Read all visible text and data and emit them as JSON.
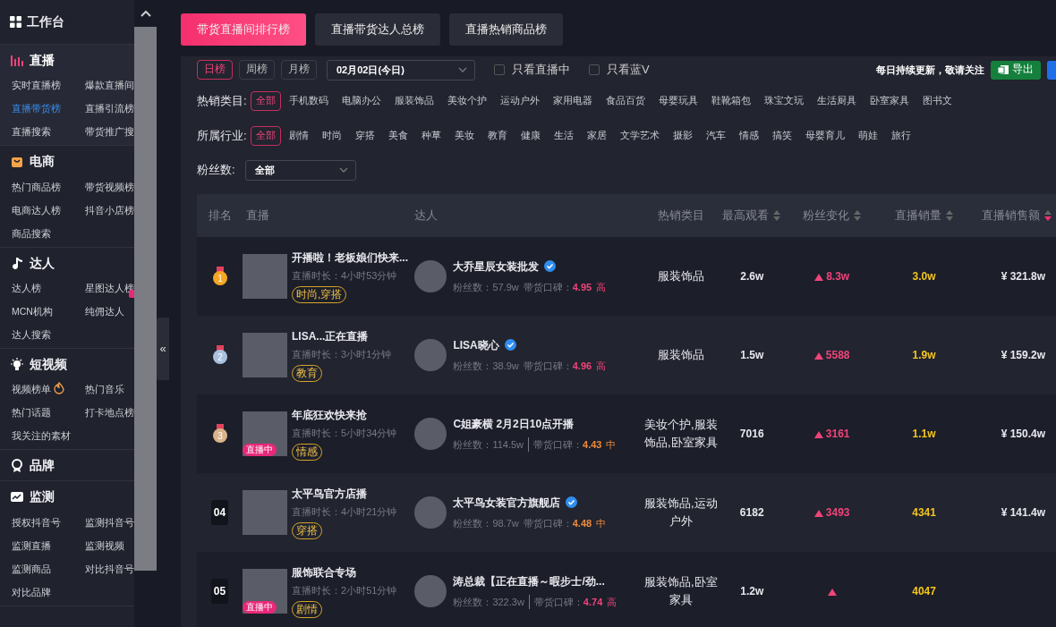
{
  "sidebar": {
    "header": "工作台",
    "sections": [
      {
        "title": "直播",
        "highlighted": true,
        "items": [
          {
            "label": "实时直播榜",
            "selected": false
          },
          {
            "label": "爆款直播间",
            "selected": false
          },
          {
            "label": "直播带货榜",
            "selected": true
          },
          {
            "label": "直播引流榜",
            "selected": false
          },
          {
            "label": "直播搜索",
            "selected": false
          },
          {
            "label": "带货推广搜",
            "selected": false
          }
        ]
      },
      {
        "title": "电商",
        "highlighted": false,
        "items": [
          {
            "label": "热门商品榜",
            "selected": false
          },
          {
            "label": "带货视频榜",
            "selected": false
          },
          {
            "label": "电商达人榜",
            "selected": false
          },
          {
            "label": "抖音小店榜",
            "selected": false
          },
          {
            "label": "商品搜索",
            "selected": false
          }
        ]
      },
      {
        "title": "达人",
        "highlighted": false,
        "items": [
          {
            "label": "达人榜",
            "selected": false
          },
          {
            "label": "星图达人榜",
            "selected": false,
            "badge": true
          },
          {
            "label": "MCN机构",
            "selected": false
          },
          {
            "label": "纯佣达人",
            "selected": false
          },
          {
            "label": "达人搜索",
            "selected": false
          }
        ]
      },
      {
        "title": "短视频",
        "highlighted": false,
        "items": [
          {
            "label": "视频榜单",
            "selected": false,
            "hot": true
          },
          {
            "label": "热门音乐",
            "selected": false
          },
          {
            "label": "热门话题",
            "selected": false
          },
          {
            "label": "打卡地点榜",
            "selected": false
          },
          {
            "label": "我关注的素材",
            "selected": false
          }
        ]
      },
      {
        "title": "品牌",
        "highlighted": false
      },
      {
        "title": "监测",
        "highlighted": false,
        "items": [
          {
            "label": "授权抖音号",
            "selected": false
          },
          {
            "label": "监测抖音号",
            "selected": false
          },
          {
            "label": "监测直播",
            "selected": false
          },
          {
            "label": "监测视频",
            "selected": false
          },
          {
            "label": "监测商品",
            "selected": false
          },
          {
            "label": "对比抖音号",
            "selected": false
          },
          {
            "label": "对比品牌",
            "selected": false
          }
        ]
      }
    ],
    "collapse": "«"
  },
  "tabs": [
    {
      "label": "带货直播间排行榜",
      "selected": true
    },
    {
      "label": "直播带货达人总榜",
      "selected": false
    },
    {
      "label": "直播热销商品榜",
      "selected": false
    }
  ],
  "filters": {
    "periods": [
      {
        "label": "日榜",
        "selected": true
      },
      {
        "label": "周榜",
        "selected": false
      },
      {
        "label": "月榜",
        "selected": false
      }
    ],
    "date": "02月02日(今日)",
    "checks": [
      {
        "label": "只看直播中",
        "checked": false
      },
      {
        "label": "只看蓝V",
        "checked": false
      }
    ],
    "notice": "每日持续更新，敬请关注",
    "export": "导出",
    "categories": {
      "label": "热销类目:",
      "options": [
        {
          "label": "全部",
          "selected": true
        },
        {
          "label": "手机数码",
          "selected": false
        },
        {
          "label": "电脑办公",
          "selected": false
        },
        {
          "label": "服装饰品",
          "selected": false
        },
        {
          "label": "美妆个护",
          "selected": false
        },
        {
          "label": "运动户外",
          "selected": false
        },
        {
          "label": "家用电器",
          "selected": false
        },
        {
          "label": "食品百货",
          "selected": false
        },
        {
          "label": "母婴玩具",
          "selected": false
        },
        {
          "label": "鞋靴箱包",
          "selected": false
        },
        {
          "label": "珠宝文玩",
          "selected": false
        },
        {
          "label": "生活厨具",
          "selected": false
        },
        {
          "label": "卧室家具",
          "selected": false
        },
        {
          "label": "图书文",
          "selected": false
        }
      ]
    },
    "industries": {
      "label": "所属行业:",
      "options": [
        {
          "label": "全部",
          "selected": true
        },
        {
          "label": "剧情",
          "selected": false
        },
        {
          "label": "时尚",
          "selected": false
        },
        {
          "label": "穿搭",
          "selected": false
        },
        {
          "label": "美食",
          "selected": false
        },
        {
          "label": "种草",
          "selected": false
        },
        {
          "label": "美妆",
          "selected": false
        },
        {
          "label": "教育",
          "selected": false
        },
        {
          "label": "健康",
          "selected": false
        },
        {
          "label": "生活",
          "selected": false
        },
        {
          "label": "家居",
          "selected": false
        },
        {
          "label": "文学艺术",
          "selected": false
        },
        {
          "label": "摄影",
          "selected": false
        },
        {
          "label": "汽车",
          "selected": false
        },
        {
          "label": "情感",
          "selected": false
        },
        {
          "label": "搞笑",
          "selected": false
        },
        {
          "label": "母婴育儿",
          "selected": false
        },
        {
          "label": "萌娃",
          "selected": false
        },
        {
          "label": "旅行",
          "selected": false
        }
      ]
    },
    "fans": {
      "label": "粉丝数:",
      "value": "全部"
    }
  },
  "table": {
    "columns": [
      {
        "label": "排名"
      },
      {
        "label": "直播"
      },
      {
        "label": "达人"
      },
      {
        "label": "热销类目"
      },
      {
        "label": "最高观看",
        "sorted_desc": false
      },
      {
        "label": "粉丝变化",
        "sorted_desc": false
      },
      {
        "label": "直播销量",
        "sorted_desc": false
      },
      {
        "label": "直播销售额",
        "sorted_desc": true
      }
    ],
    "rows": [
      {
        "rank": "1",
        "kind": "medal",
        "color": "#f5a623",
        "title": "开播啦！老板娘们快来...",
        "duration": "直播时长：4小时53分钟",
        "tag": "时尚,穿搭",
        "live": false,
        "talent": "大乔星辰女装批发",
        "verified": true,
        "fans": "粉丝数：57.9w",
        "divider": false,
        "rating_label": "带货口碑：",
        "rating": "4.95",
        "grade": "高",
        "grade_high": true,
        "category": "服装饰品",
        "peak": "2.6w",
        "fans_change": "8.3w",
        "sales": "3.0w",
        "amount": "¥ 321.8w"
      },
      {
        "rank": "2",
        "kind": "medal",
        "color": "#a9c1dd",
        "title": "LISA...正在直播",
        "duration": "直播时长：3小时1分钟",
        "tag": "教育",
        "live": false,
        "talent": "LISA晓心",
        "verified": true,
        "fans": "粉丝数：38.9w",
        "divider": false,
        "rating_label": "带货口碑：",
        "rating": "4.96",
        "grade": "高",
        "grade_high": true,
        "category": "服装饰品",
        "peak": "1.5w",
        "fans_change": "5588",
        "sales": "1.9w",
        "amount": "¥ 159.2w"
      },
      {
        "rank": "3",
        "kind": "medal",
        "color": "#d9b48a",
        "title": "年底狂欢快来抢",
        "duration": "直播时长：5小时34分钟",
        "tag": "情感",
        "live": true,
        "live_label": "直播中",
        "talent": "C姐豪横 2月2日10点开播",
        "verified": false,
        "fans": "粉丝数：114.5w",
        "divider": true,
        "rating_label": "带货口碑：",
        "rating": "4.43",
        "grade": "中",
        "grade_high": false,
        "category": "美妆个护,服装饰品,卧室家具",
        "peak": "7016",
        "fans_change": "3161",
        "sales": "1.1w",
        "amount": "¥ 150.4w"
      },
      {
        "rank": "04",
        "kind": "number",
        "title": "太平鸟官方店播",
        "duration": "直播时长：4小时21分钟",
        "tag": "穿搭",
        "live": false,
        "talent": "太平鸟女装官方旗舰店",
        "verified": true,
        "fans": "粉丝数：98.7w",
        "divider": false,
        "rating_label": "带货口碑：",
        "rating": "4.48",
        "grade": "中",
        "grade_high": false,
        "category": "服装饰品,运动户外",
        "peak": "6182",
        "fans_change": "3493",
        "sales": "4341",
        "amount": "¥ 141.4w"
      },
      {
        "rank": "05",
        "kind": "number",
        "title": "服饰联合专场",
        "duration": "直播时长：2小时51分钟",
        "tag": "剧情",
        "live": true,
        "live_label": "直播中",
        "talent": "涛总裁【正在直播～暇步士/劲...",
        "verified": false,
        "fans": "粉丝数：322.3w",
        "divider": true,
        "rating_label": "带货口碑：",
        "rating": "4.74",
        "grade": "高",
        "grade_high": true,
        "category": "服装饰品,卧室家具",
        "peak": "1.2w",
        "sales": "4047"
      }
    ]
  }
}
